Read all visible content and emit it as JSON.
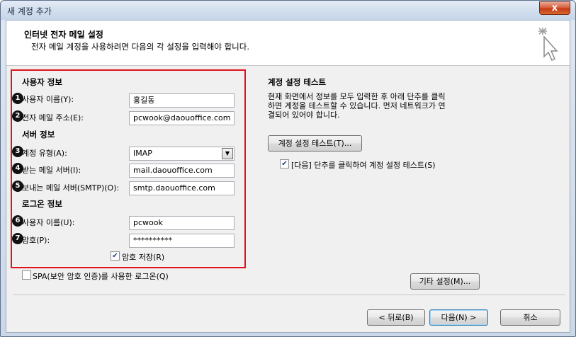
{
  "window": {
    "title": "새 계정 추가",
    "close_label": "x"
  },
  "header": {
    "title": "인터넷 전자 메일 설정",
    "subtitle": "전자 메일 계정을 사용하려면 다음의 각 설정을 입력해야 합니다."
  },
  "user_info": {
    "section_title": "사용자 정보",
    "name_label": "사용자 이름(Y):",
    "name_value": "홍길동",
    "email_label": "전자 메일 주소(E):",
    "email_value": "pcwook@daouoffice.com"
  },
  "server_info": {
    "section_title": "서버 정보",
    "account_type_label": "계정 유형(A):",
    "account_type_value": "IMAP",
    "incoming_label": "받는 메일 서버(I):",
    "incoming_value": "mail.daouoffice.com",
    "outgoing_label": "보내는 메일 서버(SMTP)(O):",
    "outgoing_value": "smtp.daouoffice.com"
  },
  "login_info": {
    "section_title": "로그온 정보",
    "username_label": "사용자 이름(U):",
    "username_value": "pcwook",
    "password_label": "암호(P):",
    "password_value": "**********",
    "save_password_label": "암호 저장(R)",
    "save_password_checked": true
  },
  "spa": {
    "label": "SPA(보안 암호 인증)를 사용한 로그온(Q)",
    "checked": false
  },
  "test": {
    "section_title": "계정 설정 테스트",
    "description": "현재 화면에서 정보를 모두 입력한 후 아래 단추를 클릭\n하면 계정을 테스트할 수 있습니다. 먼저 네트워크가 연\n결되어 있어야 합니다.",
    "button_label": "계정 설정 테스트(T)...",
    "auto_test_label": "[다음] 단추를 클릭하여 계정 설정 테스트(S)",
    "auto_test_checked": true
  },
  "more_settings_label": "기타 설정(M)...",
  "footer": {
    "back_label": "< 뒤로(B)",
    "next_label": "다음(N) >",
    "cancel_label": "취소"
  },
  "badges": [
    "1",
    "2",
    "3",
    "4",
    "5",
    "6",
    "7"
  ],
  "colors": {
    "highlight_border": "#e0141e",
    "close_button": "#c53a17"
  }
}
